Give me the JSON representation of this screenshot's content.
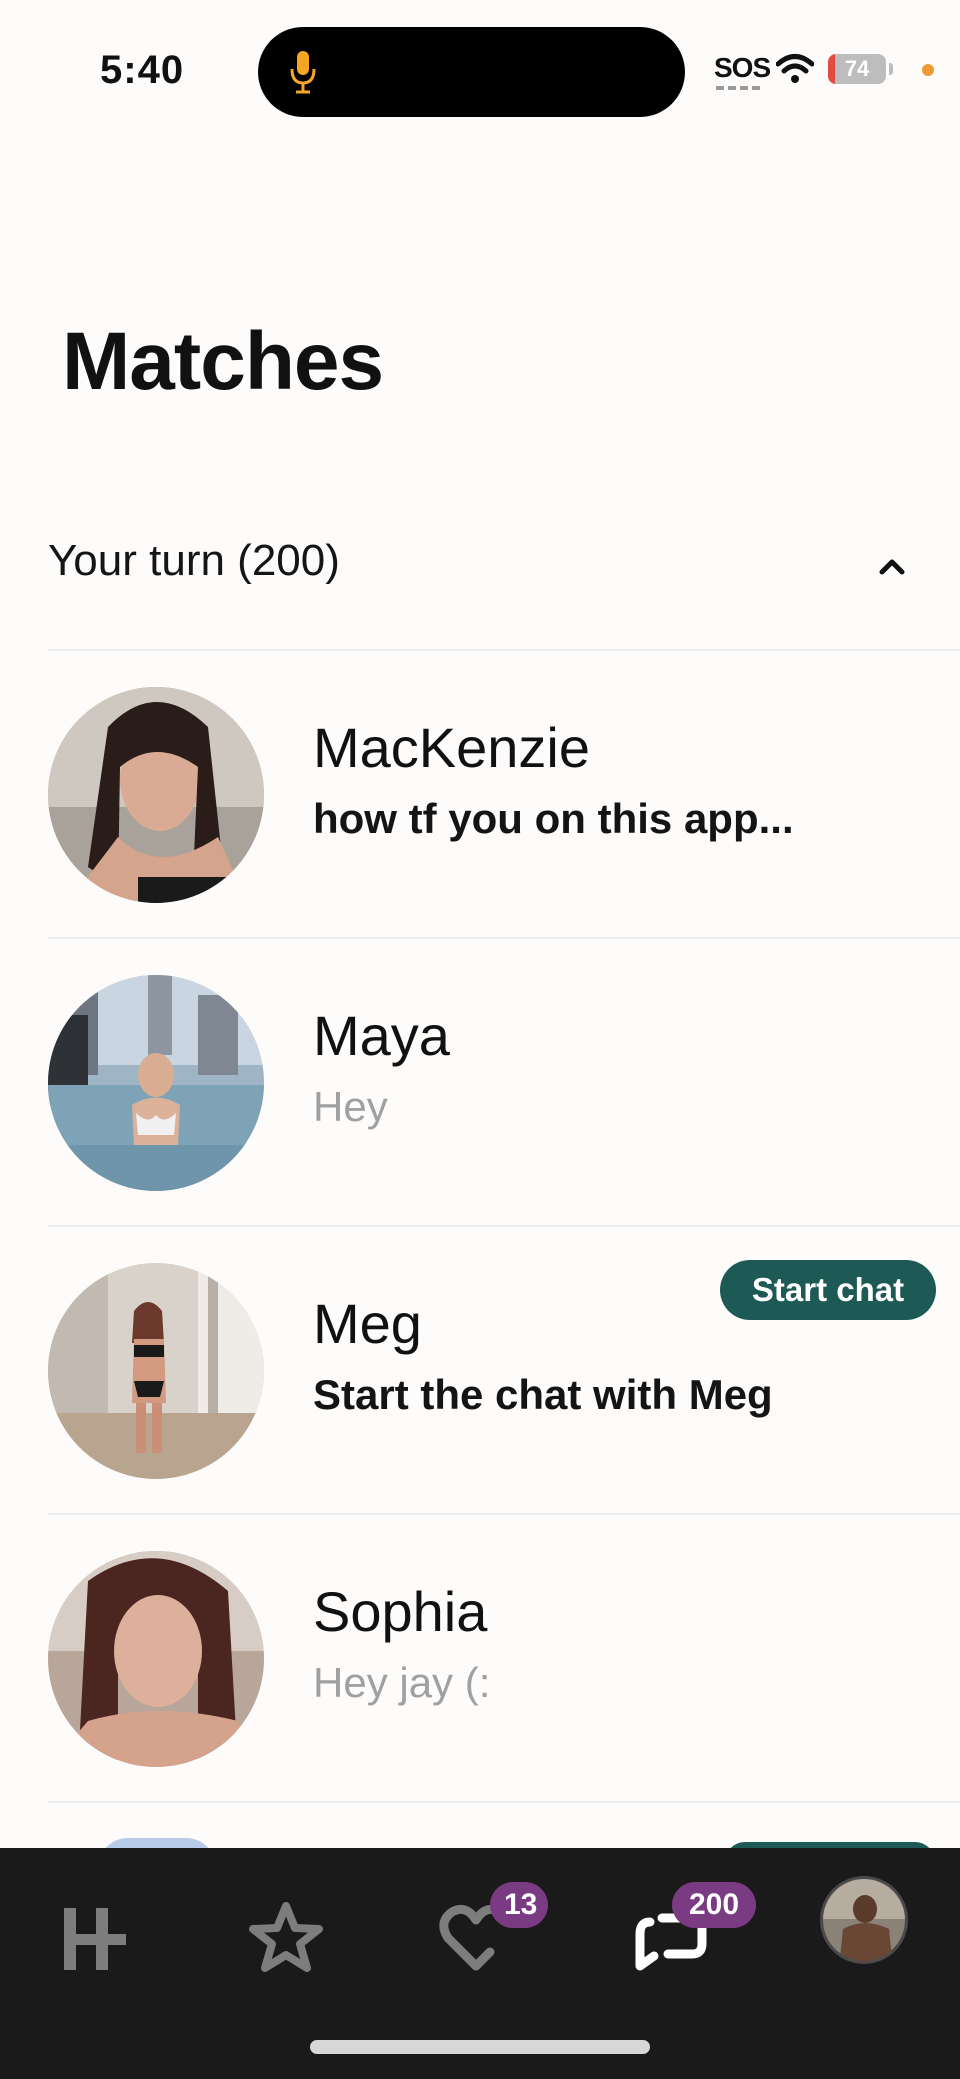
{
  "status_bar": {
    "time": "5:40",
    "sos": "SOS",
    "battery": "74",
    "icons": [
      "microphone-icon",
      "wifi-icon",
      "battery-icon"
    ]
  },
  "page": {
    "title": "Matches"
  },
  "section": {
    "title": "Your turn (200)",
    "toggle_icon": "chevron-up-icon"
  },
  "matches": [
    {
      "name": "MacKenzie",
      "message": "how tf you on this app...",
      "message_style": "unread",
      "badge": ""
    },
    {
      "name": "Maya",
      "message": "Hey",
      "message_style": "read",
      "badge": ""
    },
    {
      "name": "Meg",
      "message": "Start the chat with Meg",
      "message_style": "prompt",
      "badge": "Start chat"
    },
    {
      "name": "Sophia",
      "message": "Hey jay (:",
      "message_style": "read",
      "badge": ""
    }
  ],
  "bottom_nav": {
    "items": [
      {
        "name": "home",
        "icon": "hinge-logo-icon"
      },
      {
        "name": "standouts",
        "icon": "star-icon"
      },
      {
        "name": "likes",
        "icon": "heart-icon",
        "badge": "13"
      },
      {
        "name": "matches",
        "icon": "chat-icon",
        "badge": "200",
        "active": true
      },
      {
        "name": "profile",
        "icon": "profile-avatar"
      }
    ]
  },
  "colors": {
    "background": "#fdfcfb",
    "accent_teal": "#1e5a55",
    "badge_purple": "#7a3b82",
    "nav_background": "#1a1a1a",
    "muted_text": "#a0a0a0"
  }
}
